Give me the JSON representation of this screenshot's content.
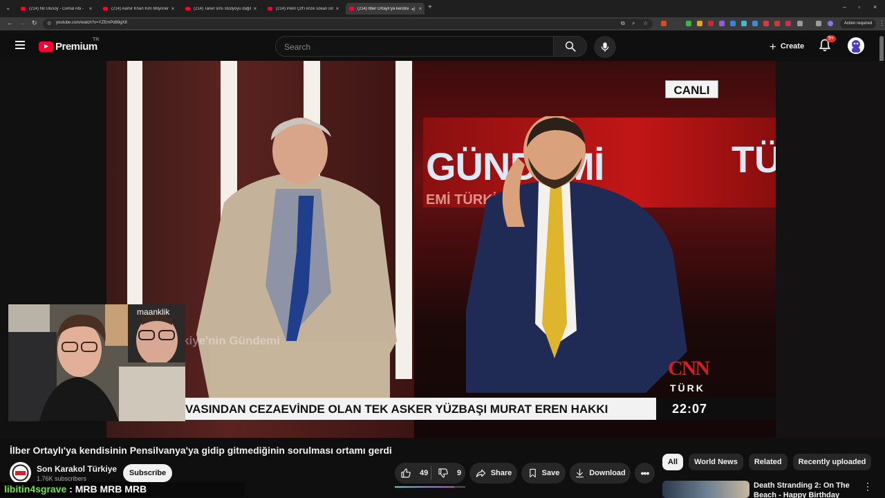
{
  "browser": {
    "tabs": [
      {
        "title": "(214) Nil Ulusoy - Cemal Abi -"
      },
      {
        "title": "(214) Aamir Khan Kim Milyoner"
      },
      {
        "title": "(214) Taner sins stüdyoyu dağıt"
      },
      {
        "title": "(214) Pelin Çift'i krize sokan cin"
      },
      {
        "title": "(214) İlber Ortaylı'ya kendisi"
      }
    ],
    "url": "youtube.com/watch?v=YZEmPd89gX8",
    "action_required": "Action required"
  },
  "header": {
    "logo_text": "Premium",
    "logo_country": "TR",
    "search_placeholder": "Search",
    "create_label": "Create",
    "notifications_badge": "9+"
  },
  "video": {
    "live_label": "CANLI",
    "screen_text_left": "GÜNDEMİ",
    "screen_text_right": "TÜ",
    "screen_subtext": "EMİ TÜRKİY",
    "watermark": "kiye'nin Gündemi",
    "ticker": "VASINDAN CEZAEVİNDE OLAN TEK ASKER YÜZBAŞI MURAT EREN HAKKI",
    "network": "CNN",
    "network_sub": "TÜRK",
    "clock": "22:07"
  },
  "webcam": {
    "tag": "maanklik"
  },
  "info": {
    "title": "İlber Ortaylı'ya kendisinin Pensilvanya'ya gidip gitmediğinin sorulması ortamı gerdi",
    "channel": "Son Karakol Türkiye",
    "subscribers": "1.76K subscribers",
    "subscribe_label": "Subscribe",
    "likes": "49",
    "dislikes": "9",
    "like_ratio": 0.84,
    "share_label": "Share",
    "save_label": "Save",
    "download_label": "Download"
  },
  "chat": {
    "user": "libitin4sgrave",
    "message": " : MRB MRB MRB"
  },
  "sidebar": {
    "chips": [
      "All",
      "World News",
      "Related",
      "Recently uploaded"
    ],
    "rec_title": "Death Stranding 2: On The Beach - Happy Birthday Short"
  }
}
